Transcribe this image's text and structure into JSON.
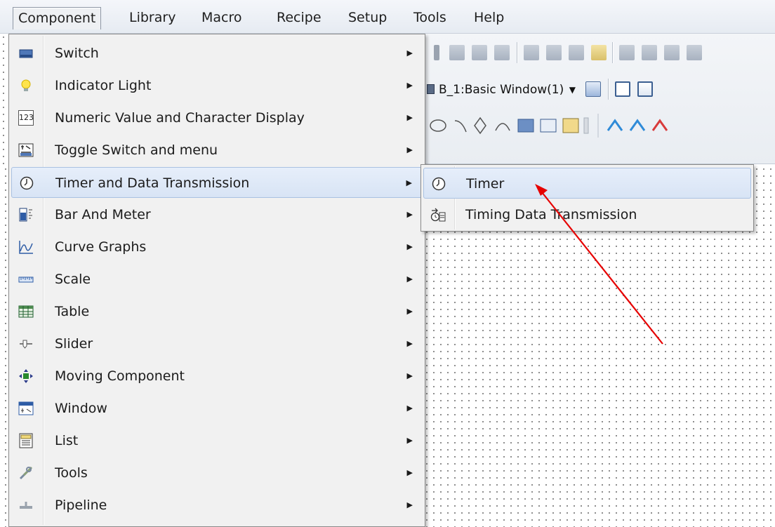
{
  "menubar": {
    "items": [
      {
        "label": "Component",
        "active": true
      },
      {
        "label": "Library"
      },
      {
        "label": "Macro"
      },
      {
        "label": "Recipe"
      },
      {
        "label": "Setup"
      },
      {
        "label": "Tools"
      },
      {
        "label": "Help"
      }
    ]
  },
  "toolbar": {
    "window_combo": "B_1:Basic Window(1)"
  },
  "component_menu": {
    "items": [
      {
        "label": "Switch",
        "icon": "switch-icon"
      },
      {
        "label": "Indicator Light",
        "icon": "indicator-light-icon"
      },
      {
        "label": "Numeric Value and Character Display",
        "icon": "numeric-display-icon",
        "icon_text": "123"
      },
      {
        "label": "Toggle Switch and menu",
        "icon": "toggle-switch-icon"
      },
      {
        "label": "Timer and Data Transmission",
        "icon": "clock-icon",
        "highlighted": true
      },
      {
        "label": "Bar And Meter",
        "icon": "bar-meter-icon"
      },
      {
        "label": "Curve Graphs",
        "icon": "curve-graph-icon"
      },
      {
        "label": "Scale",
        "icon": "scale-icon"
      },
      {
        "label": "Table",
        "icon": "table-icon"
      },
      {
        "label": "Slider",
        "icon": "slider-icon"
      },
      {
        "label": "Moving Component",
        "icon": "move-arrows-icon"
      },
      {
        "label": "Window",
        "icon": "window-icon"
      },
      {
        "label": "List",
        "icon": "list-icon"
      },
      {
        "label": "Tools",
        "icon": "tools-icon"
      },
      {
        "label": "Pipeline",
        "icon": "pipeline-icon"
      }
    ]
  },
  "timer_submenu": {
    "items": [
      {
        "label": "Timer",
        "icon": "clock-icon",
        "highlighted": true
      },
      {
        "label": "Timing Data Transmission",
        "icon": "timing-data-icon"
      }
    ]
  },
  "annotation": {
    "arrow_color": "#e60000"
  },
  "colors": {
    "highlight": "#dbe6f6",
    "menu_background": "#f1f1f1"
  }
}
